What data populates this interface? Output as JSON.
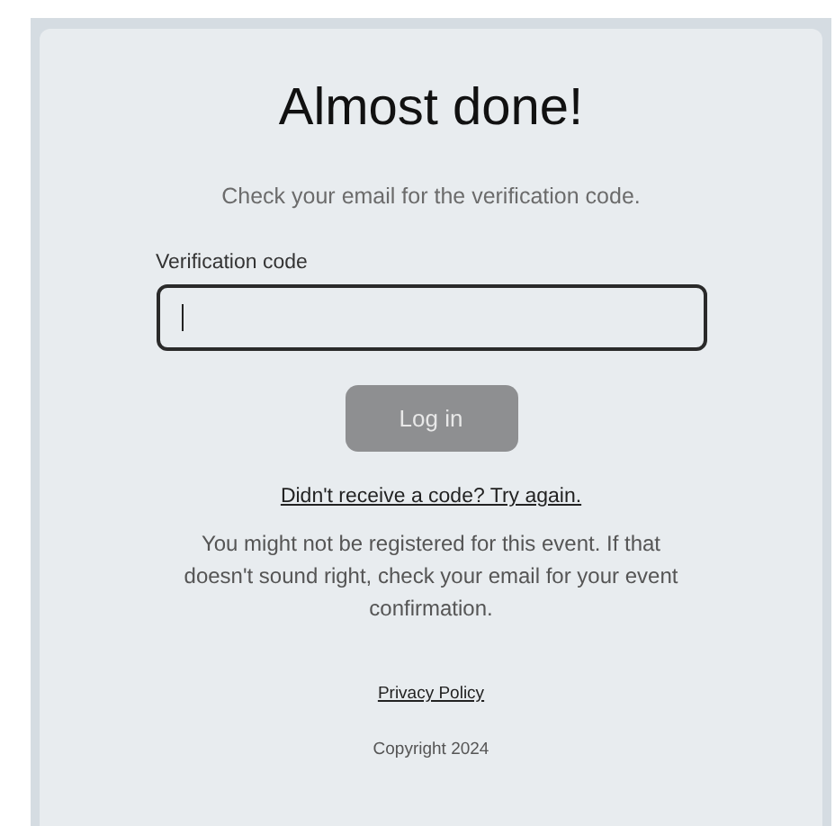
{
  "title": "Almost done!",
  "subtitle": "Check your email for the verification code.",
  "code_field": {
    "label": "Verification code",
    "focused": true
  },
  "login_button": {
    "label": "Log in",
    "disabled": true
  },
  "retry_link": "Didn't receive a code? Try again.",
  "notice": "You might not be registered for this event. If that doesn't sound right, check your email for your event confirmation.",
  "privacy_link": "Privacy Policy",
  "copyright": "Copyright 2024"
}
